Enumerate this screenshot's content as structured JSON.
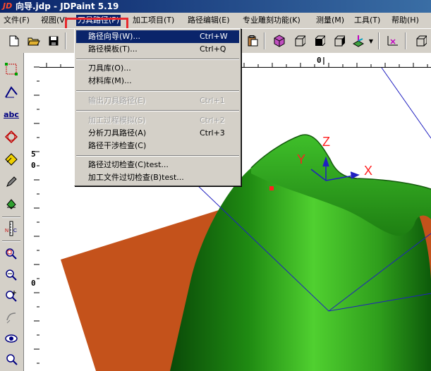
{
  "window": {
    "title": "向导.jdp - JDPaint 5.19",
    "title_visible": "向导.jdp - JDPaint 5.19"
  },
  "menubar": [
    {
      "label": "文件(F)"
    },
    {
      "label": "视图(V)"
    },
    {
      "label": "刀具路径(P)"
    },
    {
      "label": "加工项目(T)"
    },
    {
      "label": "路径编辑(E)"
    },
    {
      "label": "专业雕刻功能(K)"
    },
    {
      "label": "测量(M)"
    },
    {
      "label": "工具(T)"
    },
    {
      "label": "帮助(H)"
    }
  ],
  "dropdown": {
    "items": [
      {
        "label": "路径向导(W)...",
        "shortcut": "Ctrl+W"
      },
      {
        "label": "路径模板(T)...",
        "shortcut": "Ctrl+Q"
      },
      {
        "label": "刀具库(O)...",
        "shortcut": ""
      },
      {
        "label": "材料库(M)...",
        "shortcut": ""
      },
      {
        "label": "输出刀具路径(E)",
        "shortcut": "Ctrl+1"
      },
      {
        "label": "加工过程模拟(S)",
        "shortcut": "Ctrl+2"
      },
      {
        "label": "分析刀具路径(A)",
        "shortcut": "Ctrl+3"
      },
      {
        "label": "路径干涉检查(C)",
        "shortcut": ""
      },
      {
        "label": "路径过切检查(C)test...",
        "shortcut": ""
      },
      {
        "label": "加工文件过切检查(B)test...",
        "shortcut": ""
      }
    ]
  },
  "rulers": {
    "h_label": "0|",
    "v_labels": [
      "5",
      "0",
      "0"
    ]
  },
  "viewport": {
    "axis_labels": {
      "x": "X",
      "y": "Y",
      "z": "Z"
    },
    "colors": {
      "surface": "#2f9e1c",
      "plane": "#c4521b",
      "axis": "#ff2020",
      "frame": "#2020c0"
    }
  }
}
